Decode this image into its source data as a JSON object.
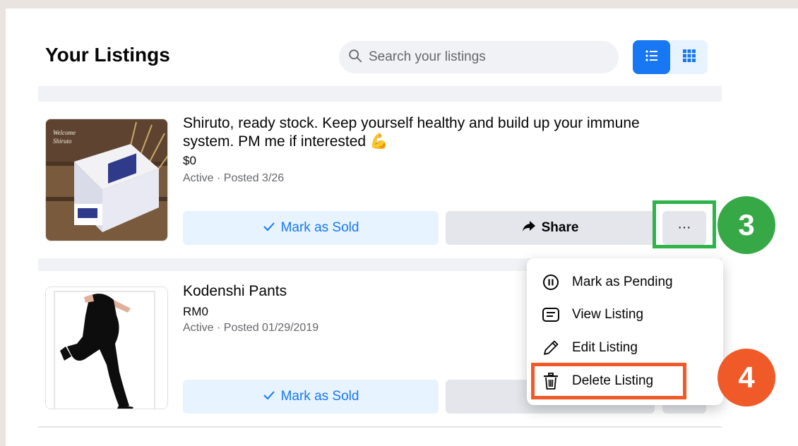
{
  "header": {
    "title": "Your Listings",
    "search_placeholder": "Search your listings",
    "view_toggle": {
      "list_icon": "list-icon",
      "grid_icon": "grid-icon",
      "active": "list"
    }
  },
  "listings": [
    {
      "title": "Shiruto, ready stock. Keep yourself healthy and build up your immune system. PM me if interested",
      "emoji": "💪",
      "price": "$0",
      "status": "Active · Posted 3/26",
      "mark_sold_label": "Mark as Sold",
      "share_label": "Share",
      "more_label": "···"
    },
    {
      "title": "Kodenshi Pants",
      "price": "RM0",
      "status": "Active · Posted 01/29/2019",
      "mark_sold_label": "Mark as Sold"
    }
  ],
  "menu": {
    "items": [
      {
        "label": "Mark as Pending",
        "icon": "pause-circle-icon"
      },
      {
        "label": "View Listing",
        "icon": "listing-icon"
      },
      {
        "label": "Edit Listing",
        "icon": "pencil-icon"
      },
      {
        "label": "Delete Listing",
        "icon": "trash-icon"
      }
    ]
  },
  "annotations": {
    "step3": "3",
    "step4": "4",
    "colors": {
      "green": "#2fb34a",
      "orange": "#f05a28",
      "brand": "#1877f2"
    }
  }
}
